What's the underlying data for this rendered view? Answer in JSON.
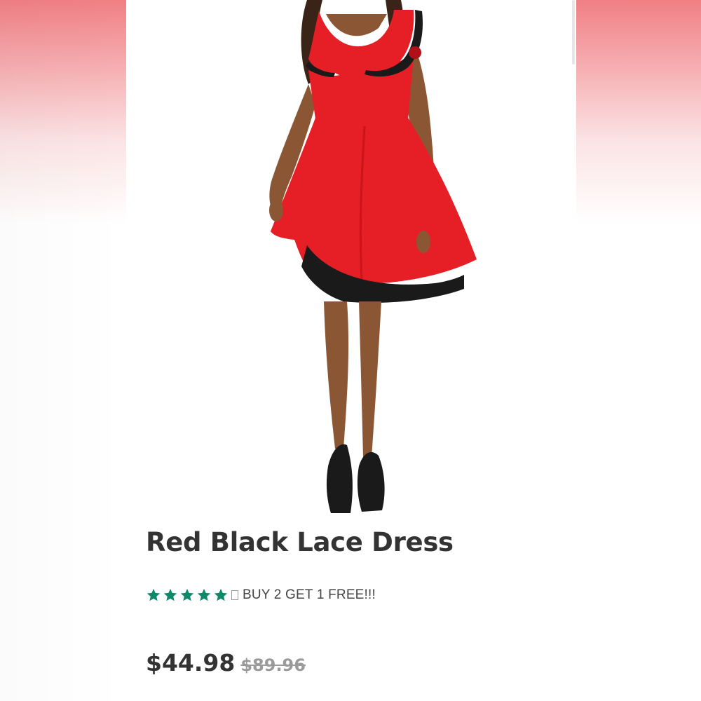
{
  "product": {
    "title": "Red Black Lace Dress",
    "rating": 5,
    "rating_max": 5,
    "promo_text": "BUY 2 GET 1 FREE!!!",
    "price_current": "$44.98",
    "price_original": "$89.96",
    "image_icon": "red-dress-product-photo",
    "star_icon": "star-icon"
  },
  "colors": {
    "accent_star": "#0e8a6a",
    "dress_red": "#e61e25",
    "lace_black": "#1a1a1a",
    "background_top": "#f07f84"
  }
}
